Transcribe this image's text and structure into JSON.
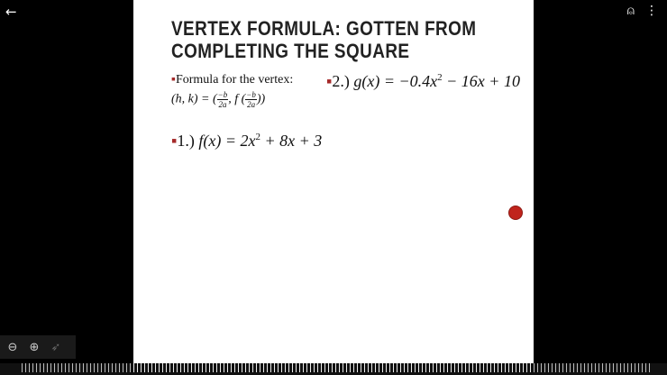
{
  "toolbar": {
    "back_icon": "arrow-left-icon",
    "back_glyph": "←",
    "account_icon": "account-question-icon",
    "account_glyph": "⍝",
    "menu_icon": "more-vertical-icon",
    "menu_glyph": "⋮"
  },
  "slide": {
    "title_line1": "VERTEX FORMULA: GOTTEN FROM",
    "title_line2": "COMPLETING THE SQUARE",
    "bullet_glyph": "▪",
    "formula_label": "Formula for the vertex:",
    "formula_prefix": "(h, k) = (",
    "frac_num": "−b",
    "frac_den": "2a",
    "formula_mid": ", f (",
    "formula_end": "))",
    "problem2_num": "2.)",
    "problem2_expr_a": "g(x) = −0.4x",
    "problem2_expr_b": "2",
    "problem2_expr_c": " − 16x + 10",
    "problem1_num": "1.)",
    "problem1_expr_a": "f(x) = 2x",
    "problem1_expr_b": "2",
    "problem1_expr_c": " + 8x + 3"
  },
  "zoom": {
    "zoom_out_glyph": "⊖",
    "zoom_in_glyph": "⊕",
    "laser_glyph": "➶"
  },
  "colors": {
    "accent_bullet": "#a52a2a",
    "pointer": "#c0241c"
  }
}
